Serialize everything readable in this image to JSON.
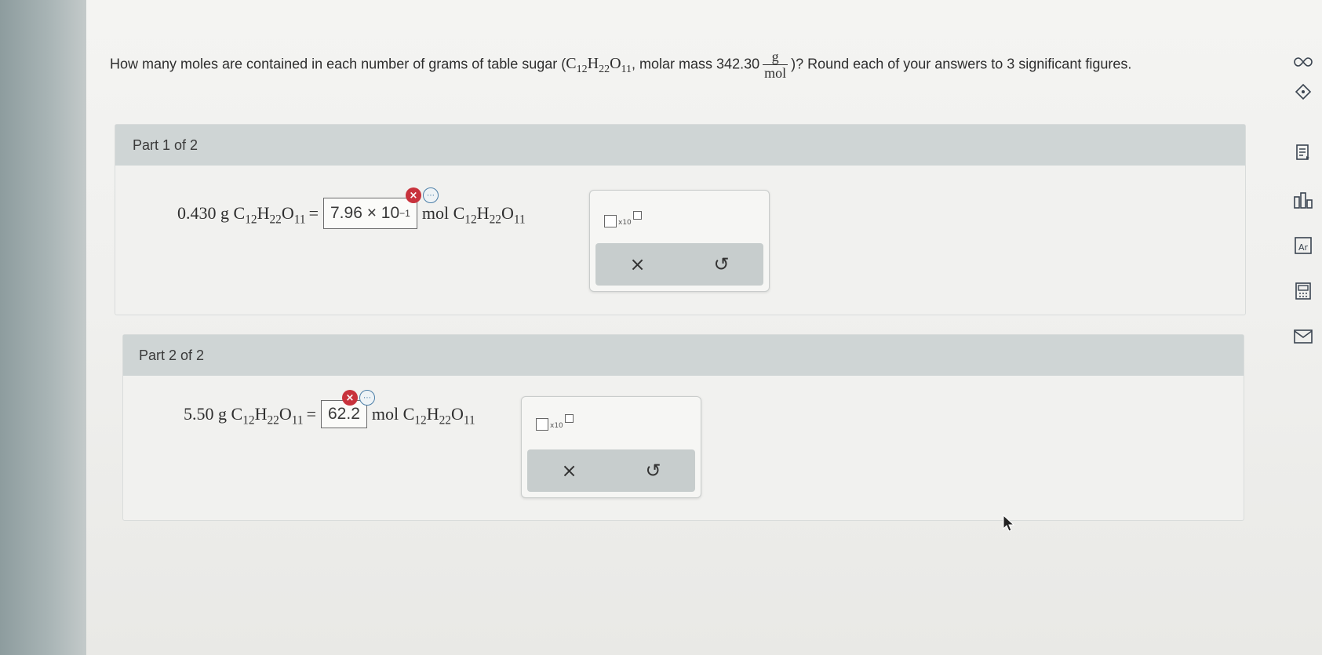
{
  "question": {
    "prefix": "How many moles are contained in each number of grams of table sugar (",
    "formula_parts": [
      "C",
      "12",
      "H",
      "22",
      "O",
      "11"
    ],
    "mid": ", molar mass 342.30",
    "unit_num": "g",
    "unit_den": "mol",
    "suffix": ")? Round each of your answers to 3 significant figures."
  },
  "parts": [
    {
      "header": "Part 1 of 2",
      "given": "0.430 g",
      "formula_parts": [
        "C",
        "12",
        "H",
        "22",
        "O",
        "11"
      ],
      "equals": "=",
      "answer_mantissa": "7.96 × 10",
      "answer_exponent": "−1",
      "unit": "mol",
      "result_formula_parts": [
        "C",
        "12",
        "H",
        "22",
        "O",
        "11"
      ],
      "status": "incorrect"
    },
    {
      "header": "Part 2 of 2",
      "given": "5.50 g",
      "formula_parts": [
        "C",
        "12",
        "H",
        "22",
        "O",
        "11"
      ],
      "equals": "=",
      "answer_mantissa": "62.2",
      "answer_exponent": "",
      "unit": "mol",
      "result_formula_parts": [
        "C",
        "12",
        "H",
        "22",
        "O",
        "11"
      ],
      "status": "incorrect"
    }
  ],
  "tools": {
    "x10_label": "x10",
    "clear_symbol": "×",
    "undo_symbol": "↺"
  },
  "icons": {
    "error": "×",
    "info": "⋯"
  },
  "sidebar": {
    "icons": [
      "infinity-icon",
      "tag-icon",
      "notes-icon",
      "chart-icon",
      "periodic-table-icon",
      "calculator-icon",
      "mail-icon"
    ]
  },
  "colors": {
    "error_red": "#c8323c",
    "info_blue": "#4c7fa8",
    "header_bg": "#cfd5d5"
  }
}
